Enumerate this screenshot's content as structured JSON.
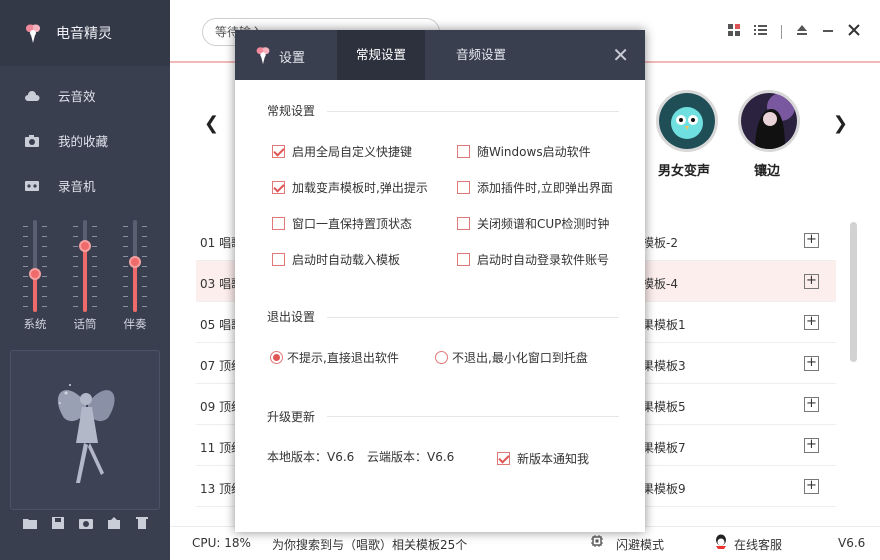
{
  "app": {
    "title": "电音精灵",
    "version": "V6.6"
  },
  "sidebar": {
    "nav": [
      {
        "label": "云音效",
        "icon": "cloud-icon"
      },
      {
        "label": "我的收藏",
        "icon": "camera-icon"
      },
      {
        "label": "录音机",
        "icon": "recorder-icon"
      }
    ],
    "sliders": [
      {
        "label": "系统",
        "level": 0.45
      },
      {
        "label": "话筒",
        "level": 0.78
      },
      {
        "label": "伴奏",
        "level": 0.6
      }
    ],
    "tools": [
      "folder-icon",
      "save-icon",
      "camera-icon",
      "export-icon",
      "trash-icon"
    ]
  },
  "header": {
    "search_value": "等待输入"
  },
  "banner": {
    "items": [
      {
        "label": "男女变声",
        "icon": "owl-avatar"
      },
      {
        "label": "镶边",
        "icon": "girl-avatar"
      }
    ]
  },
  "list": {
    "rows": [
      {
        "num": "01 唱歌",
        "name": "模板-2",
        "selected": false
      },
      {
        "num": "03 唱歌",
        "name": "模板-4",
        "selected": true
      },
      {
        "num": "05 唱歌",
        "name": "果模板1",
        "selected": false
      },
      {
        "num": "07 顶级",
        "name": "果模板3",
        "selected": false
      },
      {
        "num": "09 顶级",
        "name": "果模板5",
        "selected": false
      },
      {
        "num": "11 顶级",
        "name": "果模板7",
        "selected": false
      },
      {
        "num": "13 顶级",
        "name": "果模板9",
        "selected": false
      }
    ],
    "add_label": "+"
  },
  "status": {
    "cpu": "CPU: 18%",
    "search_result": "为你搜索到与（唱歌）相关模板25个",
    "mode": "闪避模式",
    "support": "在线客服",
    "version": "V6.6"
  },
  "dialog": {
    "title": "设置",
    "tabs": [
      "常规设置",
      "音频设置"
    ],
    "active_tab": 0,
    "general_title": "常规设置",
    "options": [
      {
        "label": "启用全局自定义快捷键",
        "checked": true
      },
      {
        "label": "随Windows启动软件",
        "checked": false
      },
      {
        "label": "加载变声模板时,弹出提示",
        "checked": true
      },
      {
        "label": "添加插件时,立即弹出界面",
        "checked": false
      },
      {
        "label": "窗口一直保持置顶状态",
        "checked": false
      },
      {
        "label": "关闭频谱和CUP检测时钟",
        "checked": false
      },
      {
        "label": "启动时自动载入模板",
        "checked": false
      },
      {
        "label": "启动时自动登录软件账号",
        "checked": false
      }
    ],
    "exit_title": "退出设置",
    "exit_options": [
      {
        "label": "不提示,直接退出软件",
        "selected": true
      },
      {
        "label": "不退出,最小化窗口到托盘",
        "selected": false
      }
    ],
    "upgrade_title": "升级更新",
    "local_version": "本地版本：V6.6",
    "cloud_version": "云端版本：V6.6",
    "notify_label": "新版本通知我",
    "notify_checked": true
  }
}
